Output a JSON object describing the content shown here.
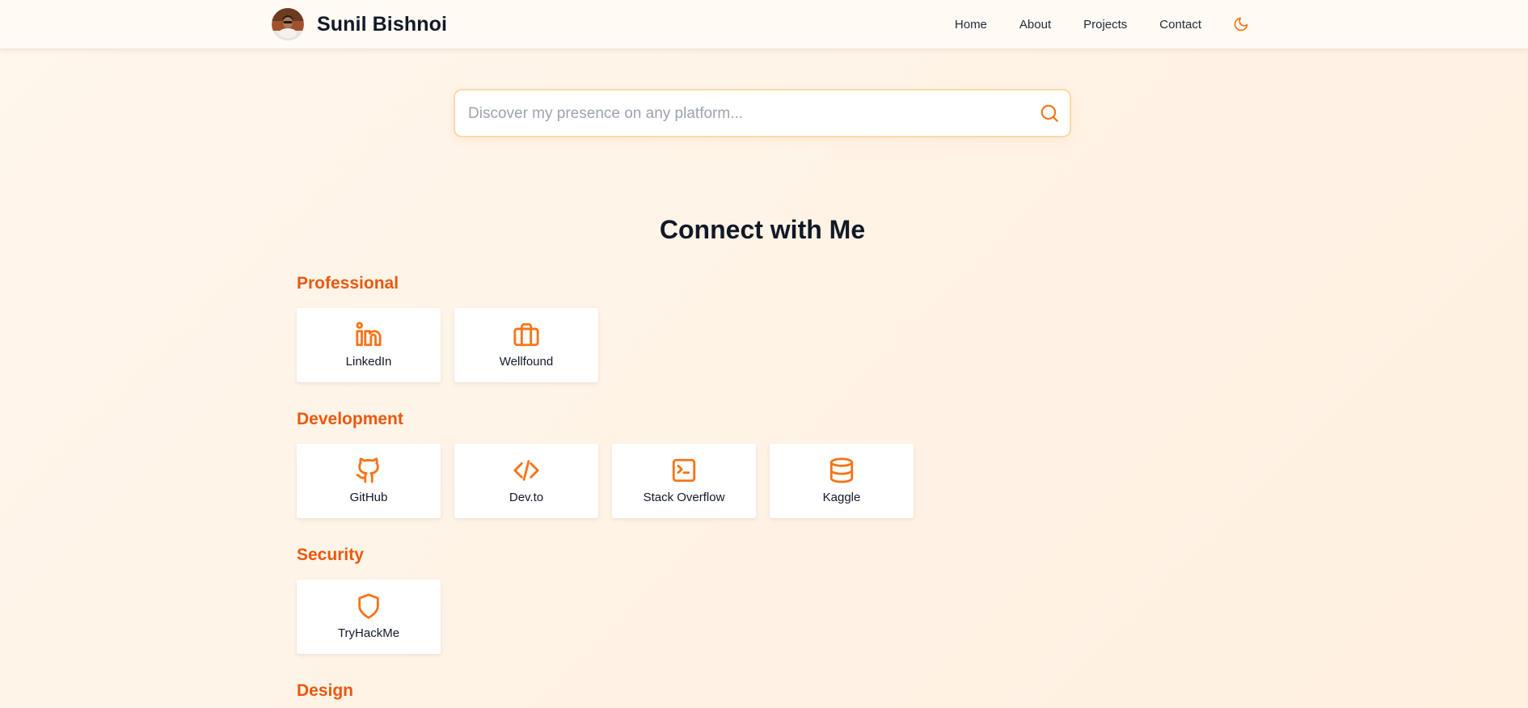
{
  "header": {
    "name": "Sunil Bishnoi",
    "avatar_icon": "profile-photo",
    "nav": [
      "Home",
      "About",
      "Projects",
      "Contact"
    ],
    "theme_toggle_icon": "moon-icon"
  },
  "search": {
    "placeholder": "Discover my presence on any platform...",
    "value": "",
    "icon": "search-icon"
  },
  "main": {
    "title": "Connect with Me",
    "categories": [
      {
        "name": "Professional",
        "platforms": [
          {
            "label": "LinkedIn",
            "icon": "linkedin-icon"
          },
          {
            "label": "Wellfound",
            "icon": "briefcase-icon"
          }
        ]
      },
      {
        "name": "Development",
        "platforms": [
          {
            "label": "GitHub",
            "icon": "github-icon"
          },
          {
            "label": "Dev.to",
            "icon": "code-icon"
          },
          {
            "label": "Stack Overflow",
            "icon": "terminal-icon"
          },
          {
            "label": "Kaggle",
            "icon": "database-icon"
          }
        ]
      },
      {
        "name": "Security",
        "platforms": [
          {
            "label": "TryHackMe",
            "icon": "shield-icon"
          }
        ]
      },
      {
        "name": "Design",
        "platforms": []
      }
    ]
  },
  "colors": {
    "accent": "#f97316",
    "category_heading": "#ea580c",
    "background": "#fff4e8",
    "text": "#111827"
  }
}
